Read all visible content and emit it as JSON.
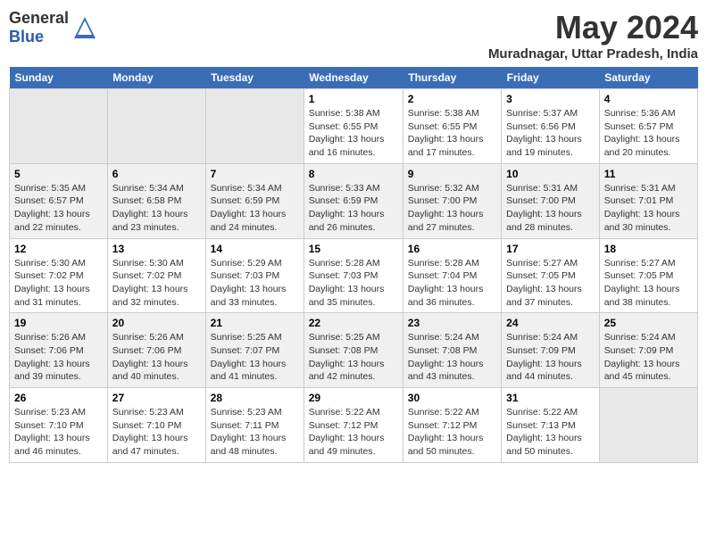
{
  "logo": {
    "general": "General",
    "blue": "Blue"
  },
  "title": "May 2024",
  "subtitle": "Muradnagar, Uttar Pradesh, India",
  "days_header": [
    "Sunday",
    "Monday",
    "Tuesday",
    "Wednesday",
    "Thursday",
    "Friday",
    "Saturday"
  ],
  "weeks": [
    [
      {
        "day": "",
        "sunrise": "",
        "sunset": "",
        "daylight": ""
      },
      {
        "day": "",
        "sunrise": "",
        "sunset": "",
        "daylight": ""
      },
      {
        "day": "",
        "sunrise": "",
        "sunset": "",
        "daylight": ""
      },
      {
        "day": "1",
        "sunrise": "Sunrise: 5:38 AM",
        "sunset": "Sunset: 6:55 PM",
        "daylight": "Daylight: 13 hours and 16 minutes."
      },
      {
        "day": "2",
        "sunrise": "Sunrise: 5:38 AM",
        "sunset": "Sunset: 6:55 PM",
        "daylight": "Daylight: 13 hours and 17 minutes."
      },
      {
        "day": "3",
        "sunrise": "Sunrise: 5:37 AM",
        "sunset": "Sunset: 6:56 PM",
        "daylight": "Daylight: 13 hours and 19 minutes."
      },
      {
        "day": "4",
        "sunrise": "Sunrise: 5:36 AM",
        "sunset": "Sunset: 6:57 PM",
        "daylight": "Daylight: 13 hours and 20 minutes."
      }
    ],
    [
      {
        "day": "5",
        "sunrise": "Sunrise: 5:35 AM",
        "sunset": "Sunset: 6:57 PM",
        "daylight": "Daylight: 13 hours and 22 minutes."
      },
      {
        "day": "6",
        "sunrise": "Sunrise: 5:34 AM",
        "sunset": "Sunset: 6:58 PM",
        "daylight": "Daylight: 13 hours and 23 minutes."
      },
      {
        "day": "7",
        "sunrise": "Sunrise: 5:34 AM",
        "sunset": "Sunset: 6:59 PM",
        "daylight": "Daylight: 13 hours and 24 minutes."
      },
      {
        "day": "8",
        "sunrise": "Sunrise: 5:33 AM",
        "sunset": "Sunset: 6:59 PM",
        "daylight": "Daylight: 13 hours and 26 minutes."
      },
      {
        "day": "9",
        "sunrise": "Sunrise: 5:32 AM",
        "sunset": "Sunset: 7:00 PM",
        "daylight": "Daylight: 13 hours and 27 minutes."
      },
      {
        "day": "10",
        "sunrise": "Sunrise: 5:31 AM",
        "sunset": "Sunset: 7:00 PM",
        "daylight": "Daylight: 13 hours and 28 minutes."
      },
      {
        "day": "11",
        "sunrise": "Sunrise: 5:31 AM",
        "sunset": "Sunset: 7:01 PM",
        "daylight": "Daylight: 13 hours and 30 minutes."
      }
    ],
    [
      {
        "day": "12",
        "sunrise": "Sunrise: 5:30 AM",
        "sunset": "Sunset: 7:02 PM",
        "daylight": "Daylight: 13 hours and 31 minutes."
      },
      {
        "day": "13",
        "sunrise": "Sunrise: 5:30 AM",
        "sunset": "Sunset: 7:02 PM",
        "daylight": "Daylight: 13 hours and 32 minutes."
      },
      {
        "day": "14",
        "sunrise": "Sunrise: 5:29 AM",
        "sunset": "Sunset: 7:03 PM",
        "daylight": "Daylight: 13 hours and 33 minutes."
      },
      {
        "day": "15",
        "sunrise": "Sunrise: 5:28 AM",
        "sunset": "Sunset: 7:03 PM",
        "daylight": "Daylight: 13 hours and 35 minutes."
      },
      {
        "day": "16",
        "sunrise": "Sunrise: 5:28 AM",
        "sunset": "Sunset: 7:04 PM",
        "daylight": "Daylight: 13 hours and 36 minutes."
      },
      {
        "day": "17",
        "sunrise": "Sunrise: 5:27 AM",
        "sunset": "Sunset: 7:05 PM",
        "daylight": "Daylight: 13 hours and 37 minutes."
      },
      {
        "day": "18",
        "sunrise": "Sunrise: 5:27 AM",
        "sunset": "Sunset: 7:05 PM",
        "daylight": "Daylight: 13 hours and 38 minutes."
      }
    ],
    [
      {
        "day": "19",
        "sunrise": "Sunrise: 5:26 AM",
        "sunset": "Sunset: 7:06 PM",
        "daylight": "Daylight: 13 hours and 39 minutes."
      },
      {
        "day": "20",
        "sunrise": "Sunrise: 5:26 AM",
        "sunset": "Sunset: 7:06 PM",
        "daylight": "Daylight: 13 hours and 40 minutes."
      },
      {
        "day": "21",
        "sunrise": "Sunrise: 5:25 AM",
        "sunset": "Sunset: 7:07 PM",
        "daylight": "Daylight: 13 hours and 41 minutes."
      },
      {
        "day": "22",
        "sunrise": "Sunrise: 5:25 AM",
        "sunset": "Sunset: 7:08 PM",
        "daylight": "Daylight: 13 hours and 42 minutes."
      },
      {
        "day": "23",
        "sunrise": "Sunrise: 5:24 AM",
        "sunset": "Sunset: 7:08 PM",
        "daylight": "Daylight: 13 hours and 43 minutes."
      },
      {
        "day": "24",
        "sunrise": "Sunrise: 5:24 AM",
        "sunset": "Sunset: 7:09 PM",
        "daylight": "Daylight: 13 hours and 44 minutes."
      },
      {
        "day": "25",
        "sunrise": "Sunrise: 5:24 AM",
        "sunset": "Sunset: 7:09 PM",
        "daylight": "Daylight: 13 hours and 45 minutes."
      }
    ],
    [
      {
        "day": "26",
        "sunrise": "Sunrise: 5:23 AM",
        "sunset": "Sunset: 7:10 PM",
        "daylight": "Daylight: 13 hours and 46 minutes."
      },
      {
        "day": "27",
        "sunrise": "Sunrise: 5:23 AM",
        "sunset": "Sunset: 7:10 PM",
        "daylight": "Daylight: 13 hours and 47 minutes."
      },
      {
        "day": "28",
        "sunrise": "Sunrise: 5:23 AM",
        "sunset": "Sunset: 7:11 PM",
        "daylight": "Daylight: 13 hours and 48 minutes."
      },
      {
        "day": "29",
        "sunrise": "Sunrise: 5:22 AM",
        "sunset": "Sunset: 7:12 PM",
        "daylight": "Daylight: 13 hours and 49 minutes."
      },
      {
        "day": "30",
        "sunrise": "Sunrise: 5:22 AM",
        "sunset": "Sunset: 7:12 PM",
        "daylight": "Daylight: 13 hours and 50 minutes."
      },
      {
        "day": "31",
        "sunrise": "Sunrise: 5:22 AM",
        "sunset": "Sunset: 7:13 PM",
        "daylight": "Daylight: 13 hours and 50 minutes."
      },
      {
        "day": "",
        "sunrise": "",
        "sunset": "",
        "daylight": ""
      }
    ]
  ]
}
